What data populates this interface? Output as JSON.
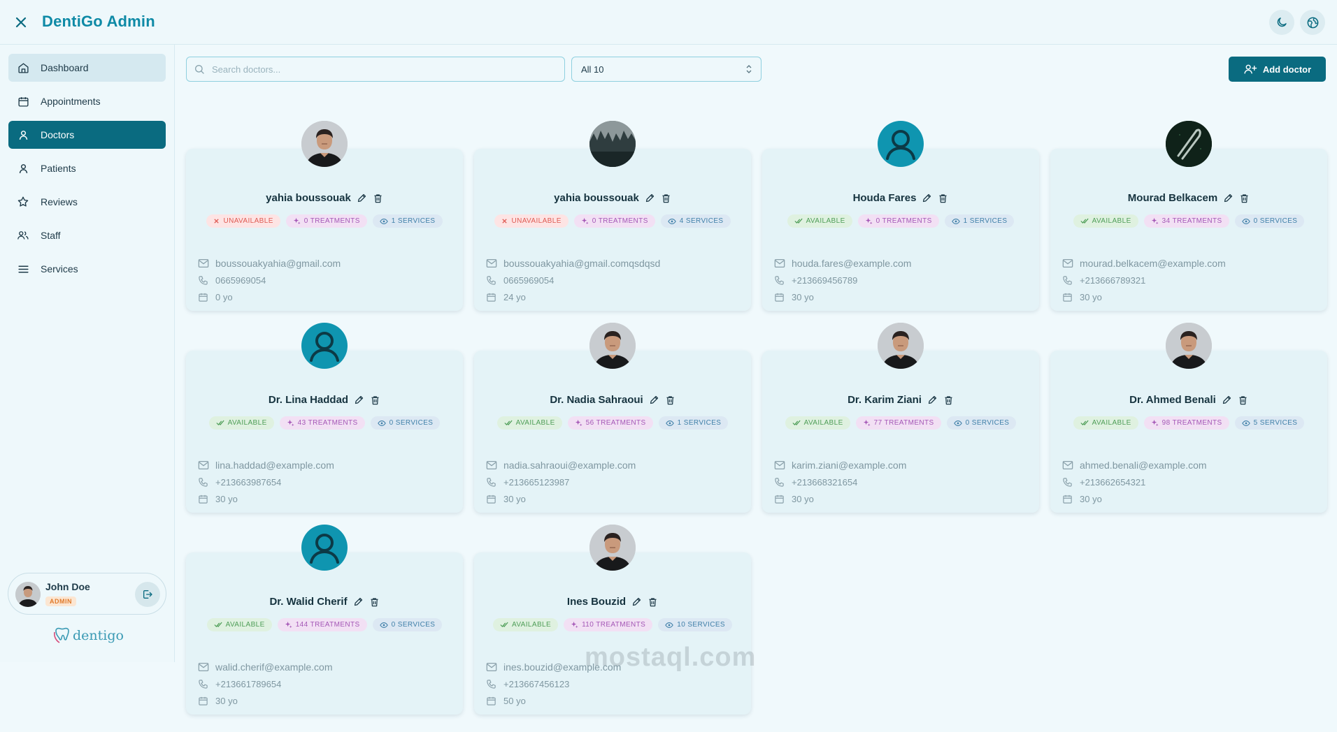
{
  "header": {
    "title": "DentiGo Admin",
    "icons": [
      "close-icon",
      "moon-icon",
      "globe-icon"
    ]
  },
  "sidebar": {
    "items": [
      {
        "label": "Dashboard",
        "icon": "home-icon"
      },
      {
        "label": "Appointments",
        "icon": "calendar-icon"
      },
      {
        "label": "Doctors",
        "icon": "user-icon"
      },
      {
        "label": "Patients",
        "icon": "user-icon"
      },
      {
        "label": "Reviews",
        "icon": "star-icon"
      },
      {
        "label": "Staff",
        "icon": "users-icon"
      },
      {
        "label": "Services",
        "icon": "menu-icon"
      }
    ],
    "active": "Doctors"
  },
  "user": {
    "name": "John Doe",
    "role": "ADMIN"
  },
  "brand": {
    "text": "dentigo"
  },
  "toolbar": {
    "search_placeholder": "Search doctors...",
    "filter_value": "All 10",
    "add_label": "Add doctor"
  },
  "colors": {
    "accent": "#0a6b80",
    "title": "#0e8aa6",
    "unavailable": "#df5a52",
    "available": "#4f9e58",
    "treatments": "#a457b6",
    "services": "#3f7fa8"
  },
  "doctors": [
    {
      "name": "yahia boussouak",
      "status": "UNAVAILABLE",
      "treatments": "0 TREATMENTS",
      "services": "1 SERVICES",
      "email": "boussouakyahia@gmail.com",
      "phone": "0665969054",
      "age": "0 yo",
      "avatar": "photo"
    },
    {
      "name": "yahia boussouak",
      "status": "UNAVAILABLE",
      "treatments": "0 TREATMENTS",
      "services": "4 SERVICES",
      "email": "boussouakyahia@gmail.comqsdqsd",
      "phone": "0665969054",
      "age": "24 yo",
      "avatar": "forest"
    },
    {
      "name": "Houda Fares",
      "status": "AVAILABLE",
      "treatments": "0 TREATMENTS",
      "services": "1 SERVICES",
      "email": "houda.fares@example.com",
      "phone": "+213669456789",
      "age": "30 yo",
      "avatar": "default"
    },
    {
      "name": "Mourad Belkacem",
      "status": "AVAILABLE",
      "treatments": "34 TREATMENTS",
      "services": "0 SERVICES",
      "email": "mourad.belkacem@example.com",
      "phone": "+213666789321",
      "age": "30 yo",
      "avatar": "dark"
    },
    {
      "name": "Dr. Lina Haddad",
      "status": "AVAILABLE",
      "treatments": "43 TREATMENTS",
      "services": "0 SERVICES",
      "email": "lina.haddad@example.com",
      "phone": "+213663987654",
      "age": "30 yo",
      "avatar": "default"
    },
    {
      "name": "Dr. Nadia Sahraoui",
      "status": "AVAILABLE",
      "treatments": "56 TREATMENTS",
      "services": "1 SERVICES",
      "email": "nadia.sahraoui@example.com",
      "phone": "+213665123987",
      "age": "30 yo",
      "avatar": "photo"
    },
    {
      "name": "Dr. Karim Ziani",
      "status": "AVAILABLE",
      "treatments": "77 TREATMENTS",
      "services": "0 SERVICES",
      "email": "karim.ziani@example.com",
      "phone": "+213668321654",
      "age": "30 yo",
      "avatar": "photo"
    },
    {
      "name": "Dr. Ahmed Benali",
      "status": "AVAILABLE",
      "treatments": "98 TREATMENTS",
      "services": "5 SERVICES",
      "email": "ahmed.benali@example.com",
      "phone": "+213662654321",
      "age": "30 yo",
      "avatar": "photo"
    },
    {
      "name": "Dr. Walid Cherif",
      "status": "AVAILABLE",
      "treatments": "144 TREATMENTS",
      "services": "0 SERVICES",
      "email": "walid.cherif@example.com",
      "phone": "+213661789654",
      "age": "30 yo",
      "avatar": "default"
    },
    {
      "name": "Ines Bouzid",
      "status": "AVAILABLE",
      "treatments": "110 TREATMENTS",
      "services": "10 SERVICES",
      "email": "ines.bouzid@example.com",
      "phone": "+213667456123",
      "age": "50 yo",
      "avatar": "photo"
    }
  ],
  "watermark": "mostaql.com"
}
